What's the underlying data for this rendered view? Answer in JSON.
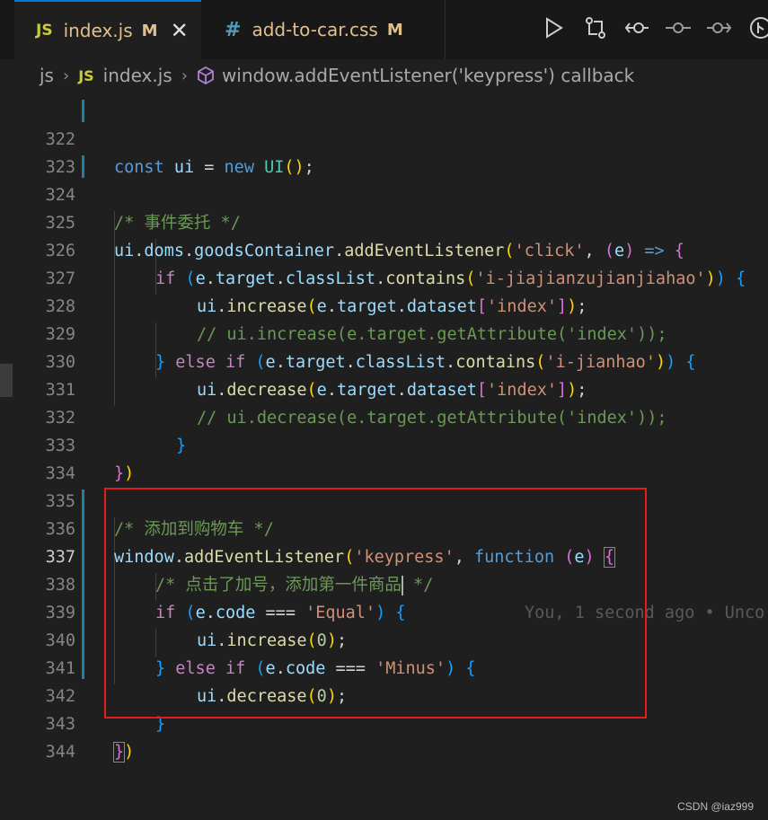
{
  "tabs": [
    {
      "icon": "JS",
      "name": "index.js",
      "badge": "M",
      "close": "✕"
    },
    {
      "icon": "#",
      "name": "add-to-car.css",
      "badge": "M"
    }
  ],
  "breadcrumb": {
    "folder": "js",
    "file_icon": "JS",
    "file": "index.js",
    "symbol": "window.addEventListener('keypress') callback"
  },
  "blame": "You, 1 second ago • Unco",
  "lines": [
    "322",
    "323",
    "324",
    "325",
    "326",
    "327",
    "328",
    "329",
    "330",
    "331",
    "332",
    "333",
    "334",
    "335",
    "336",
    "337",
    "338",
    "339",
    "340",
    "341",
    "342",
    "343",
    "344"
  ],
  "code": {
    "l322": {
      "kw": "const",
      "v1": "ui",
      "eq": " = ",
      "kw2": "new",
      "cls": "UI",
      "p1": "(",
      "p2": ")",
      "semi": ";"
    },
    "l324": "/* 事件委托 */",
    "l325": {
      "v1": "ui",
      "d1": ".",
      "v2": "doms",
      "d2": ".",
      "v3": "goodsContainer",
      "d3": ".",
      "f": "addEventListener",
      "p1": "(",
      "s": "'click'",
      "c": ", ",
      "p2": "(",
      "v4": "e",
      "p3": ")",
      "ar": " => ",
      "b": "{"
    },
    "l326": {
      "k": "if",
      "sp": " ",
      "p1": "(",
      "v1": "e",
      "d1": ".",
      "v2": "target",
      "d2": ".",
      "v3": "classList",
      "d3": ".",
      "f": "contains",
      "p2": "(",
      "s": "'i-jiajianzujianjiahao'",
      "p3": ")",
      "p4": ")",
      "sp2": " ",
      "b": "{"
    },
    "l327": {
      "v1": "ui",
      "d1": ".",
      "f": "increase",
      "p1": "(",
      "v2": "e",
      "d2": ".",
      "v3": "target",
      "d3": ".",
      "v4": "dataset",
      "b1": "[",
      "s": "'index'",
      "b2": "]",
      "p2": ")",
      "semi": ";"
    },
    "l328": "// ui.increase(e.target.getAttribute('index'));",
    "l329": {
      "b0": "}",
      "sp": " ",
      "k1": "else",
      "sp2": " ",
      "k2": "if",
      "sp3": " ",
      "p1": "(",
      "v1": "e",
      "d1": ".",
      "v2": "target",
      "d2": ".",
      "v3": "classList",
      "d3": ".",
      "f": "contains",
      "p2": "(",
      "s": "'i-jianhao'",
      "p3": ")",
      "p4": ")",
      "sp4": " ",
      "b": "{"
    },
    "l330": {
      "v1": "ui",
      "d1": ".",
      "f": "decrease",
      "p1": "(",
      "v2": "e",
      "d2": ".",
      "v3": "target",
      "d3": ".",
      "v4": "dataset",
      "b1": "[",
      "s": "'index'",
      "b2": "]",
      "p2": ")",
      "semi": ";"
    },
    "l331": "// ui.decrease(e.target.getAttribute('index'));",
    "l332": "}",
    "l333": {
      "b": "}",
      "p": ")"
    },
    "l335": "/* 添加到购物车 */",
    "l336": {
      "v1": "window",
      "d1": ".",
      "f": "addEventListener",
      "p1": "(",
      "s": "'keypress'",
      "c": ", ",
      "kw": "function",
      "sp": " ",
      "p2": "(",
      "v2": "e",
      "p3": ")",
      "sp2": " ",
      "b": "{"
    },
    "l337a": "/* 点击了加号，添加第一件商品",
    "l337b": " */",
    "l338": {
      "k": "if",
      "sp": " ",
      "p1": "(",
      "v1": "e",
      "d1": ".",
      "v2": "code",
      "op": " === ",
      "s": "'Equal'",
      "p2": ")",
      "sp2": " ",
      "b": "{"
    },
    "l339": {
      "v1": "ui",
      "d1": ".",
      "f": "increase",
      "p1": "(",
      "n": "0",
      "p2": ")",
      "semi": ";"
    },
    "l340": {
      "b0": "}",
      "sp": " ",
      "k1": "else",
      "sp2": " ",
      "k2": "if",
      "sp3": " ",
      "p1": "(",
      "v1": "e",
      "d1": ".",
      "v2": "code",
      "op": " === ",
      "s": "'Minus'",
      "p2": ")",
      "sp4": " ",
      "b": "{"
    },
    "l341": {
      "v1": "ui",
      "d1": ".",
      "f": "decrease",
      "p1": "(",
      "n": "0",
      "p2": ")",
      "semi": ";"
    },
    "l342": "}",
    "l343": {
      "b": "}",
      "p": ")"
    }
  },
  "watermark": "CSDN @iaz999"
}
